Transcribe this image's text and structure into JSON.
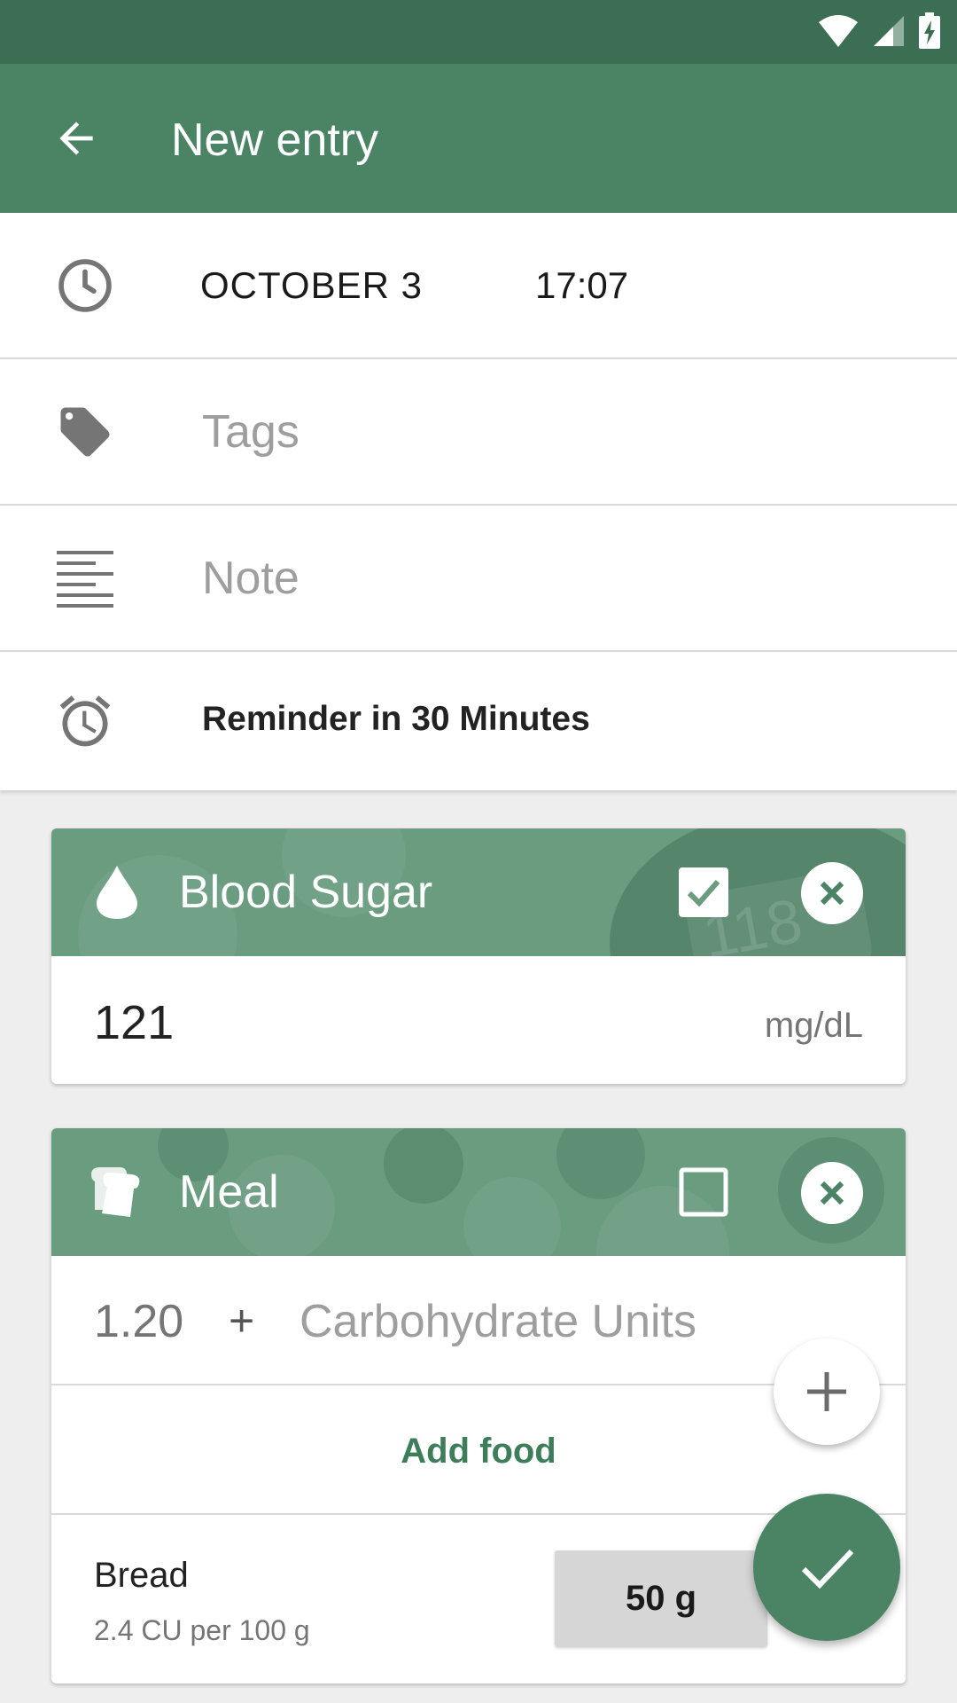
{
  "app_bar": {
    "title": "New entry",
    "back_icon": "arrow-left-icon"
  },
  "colors": {
    "primary": "#4a8465",
    "primary_dark": "#3b6e52",
    "accent": "#3d7d5a"
  },
  "form": {
    "date": "OCTOBER 3",
    "time": "17:07",
    "tags_placeholder": "Tags",
    "note_placeholder": "Note",
    "reminder": "Reminder in 30 Minutes"
  },
  "blood_sugar": {
    "title": "Blood Sugar",
    "checked": true,
    "value": "121",
    "unit": "mg/dL"
  },
  "meal": {
    "title": "Meal",
    "checked": false,
    "value": "1.20",
    "plus": "+",
    "units_placeholder": "Carbohydrate Units",
    "add_food_label": "Add food",
    "foods": [
      {
        "name": "Bread",
        "detail": "2.4 CU per 100 g",
        "amount": "50 g"
      }
    ]
  }
}
